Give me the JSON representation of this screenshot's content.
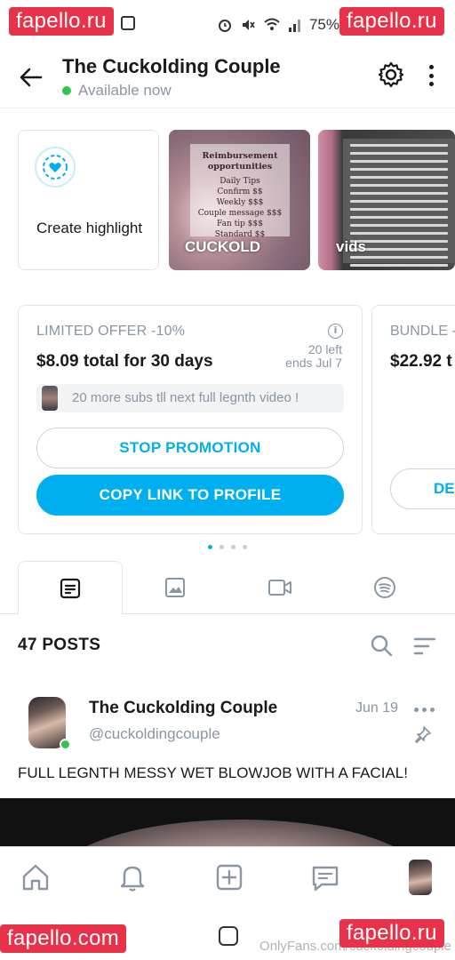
{
  "status_bar": {
    "battery": "75%"
  },
  "watermarks": {
    "text": "fapello.ru",
    "bottom_left_text": "fapello.com"
  },
  "header": {
    "title": "The Cuckolding Couple",
    "status": "Available now"
  },
  "highlights": [
    {
      "label": "Create highlight"
    },
    {
      "label": "CUCKOLD",
      "card_title": "Reimbursement opportunities",
      "card_lines": [
        "Daily Tips",
        "Confirm $$",
        "Weekly $$$",
        "Couple message $$$",
        "Fan tip $$$",
        "Standard $$"
      ]
    },
    {
      "label": "vids"
    }
  ],
  "offers": [
    {
      "title": "LIMITED OFFER -10%",
      "price": "$8.09 total for 30 days",
      "info_icon": "i",
      "left": "20 left",
      "ends": "ends Jul 7",
      "message": "20 more subs tll next full legnth video !",
      "secondary_button": "STOP PROMOTION",
      "primary_button": "COPY LINK TO PROFILE"
    },
    {
      "title": "BUNDLE -",
      "price": "$22.92 t",
      "button": "DE"
    }
  ],
  "pager": {
    "count": 4,
    "active": 0
  },
  "tabs": [
    "posts-tab",
    "photos-tab",
    "videos-tab",
    "audio-tab"
  ],
  "posts_header": {
    "count_label": "47 POSTS"
  },
  "post": {
    "author": "The Cuckolding Couple",
    "handle": "@cuckoldingcouple",
    "date": "Jun 19",
    "text": "FULL LEGNTH MESSY WET BLOWJOB WITH A FACIAL!"
  },
  "bottom_nav": [
    "home",
    "notifications",
    "add",
    "messages",
    "profile"
  ],
  "system_nav": {
    "credit": "OnlyFans.com/cuckoldingcouple"
  },
  "colors": {
    "accent": "#00aff0",
    "online": "#32c24d",
    "muted": "#8a96a3",
    "watermark": "#e8324a"
  }
}
